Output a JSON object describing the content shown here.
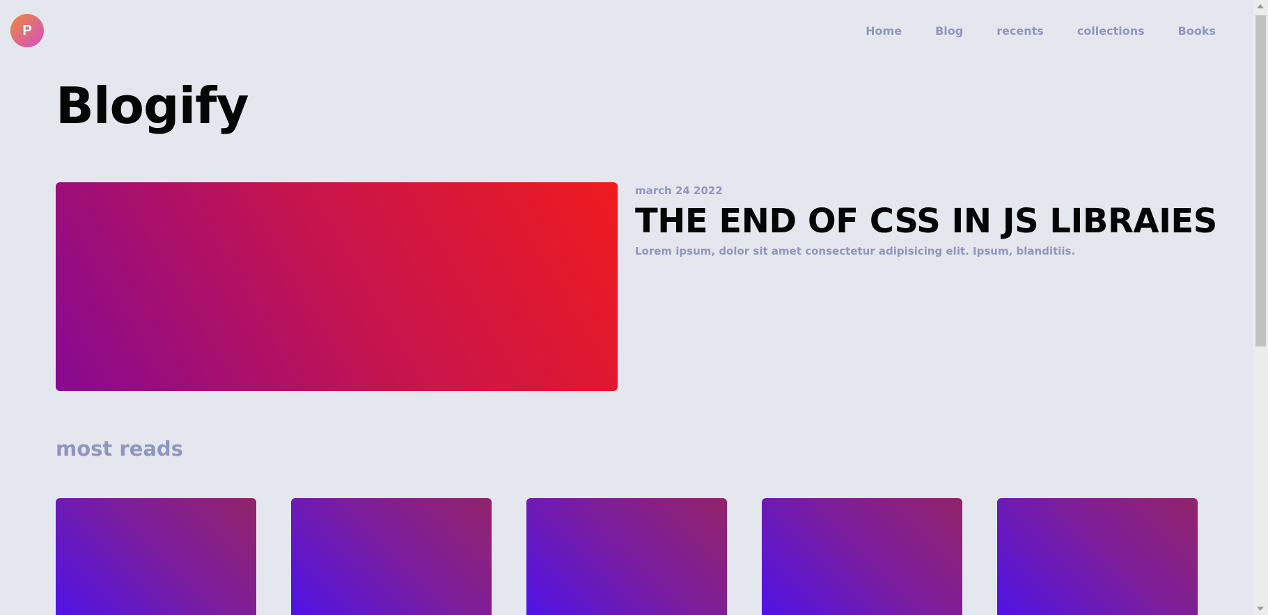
{
  "header": {
    "logo_letter": "P",
    "nav": [
      "Home",
      "Blog",
      "recents",
      "collections",
      "Books"
    ]
  },
  "site_title": "Blogify",
  "hero": {
    "date": "march 24 2022",
    "title": "THE END OF CSS IN JS LIBRAIES",
    "excerpt": "Lorem ipsum, dolor sit amet consectetur adipisicing elit. Ipsum, blanditiis."
  },
  "most_reads": {
    "title": "most reads",
    "card_count": 5
  },
  "colors": {
    "background": "#e5e7ee",
    "muted_text": "#8f97bf",
    "hero_gradient": [
      "#860a92",
      "#c4144f",
      "#ef1b1e"
    ],
    "card_gradient": [
      "#4a12f0",
      "#7a1d9f",
      "#93246a"
    ]
  }
}
